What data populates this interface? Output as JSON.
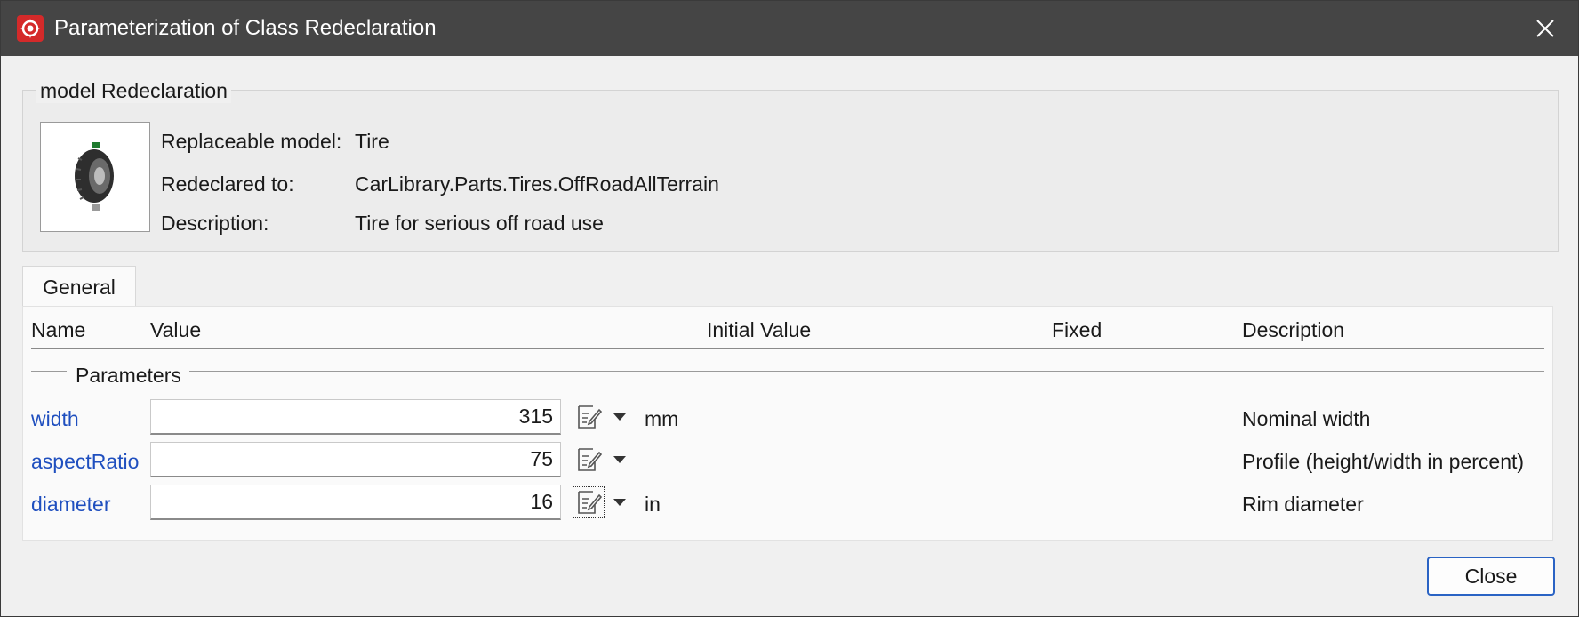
{
  "window": {
    "title": "Parameterization of Class Redeclaration"
  },
  "model": {
    "group_title": "model Redeclaration",
    "replaceable_label": "Replaceable model:",
    "replaceable_value": "Tire",
    "redeclared_label": "Redeclared to:",
    "redeclared_value": "CarLibrary.Parts.Tires.OffRoadAllTerrain",
    "description_label": "Description:",
    "description_value": "Tire for serious off road use"
  },
  "tabs": [
    {
      "label": "General",
      "active": true
    }
  ],
  "table": {
    "headers": {
      "name": "Name",
      "value": "Value",
      "initial_value": "Initial Value",
      "fixed": "Fixed",
      "description": "Description"
    },
    "section_title": "Parameters",
    "rows": [
      {
        "name": "width",
        "value": "315",
        "unit": "mm",
        "description": "Nominal width"
      },
      {
        "name": "aspectRatio",
        "value": "75",
        "unit": "",
        "description": "Profile (height/width in percent)"
      },
      {
        "name": "diameter",
        "value": "16",
        "unit": "in",
        "description": "Rim diameter"
      }
    ]
  },
  "footer": {
    "close_label": "Close"
  },
  "icons": {
    "app": "dymola-logo-icon",
    "window_close": "close-icon",
    "model_thumbnail": "tire-icon",
    "edit": "edit-icon",
    "dropdown": "caret-down-icon"
  },
  "colors": {
    "titlebar": "#454545",
    "parameter_link": "#1f4fbf",
    "app_icon": "#d42a2a",
    "default_button_border": "#2a63c4"
  }
}
